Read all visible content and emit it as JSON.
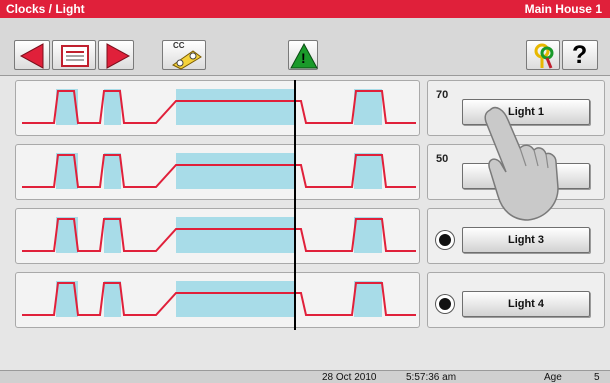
{
  "window": {
    "title": "Clocks / Light",
    "location": "Main House 1"
  },
  "toolbar": {
    "buttons": [
      {
        "icon": "arrow-left-icon"
      },
      {
        "icon": "list-card-icon"
      },
      {
        "icon": "arrow-right-icon"
      },
      {
        "icon": "clock-edit-icon",
        "badge": "CC"
      },
      {
        "icon": "warning-icon",
        "glyph": "!"
      },
      {
        "icon": "keys-icon"
      },
      {
        "icon": "help-icon",
        "glyph": "?"
      }
    ]
  },
  "lights": [
    {
      "label": "Light 1",
      "value": "70"
    },
    {
      "label": "Light 2",
      "value": "50"
    },
    {
      "label": "Light 3",
      "value": ""
    },
    {
      "label": "Light 4",
      "value": ""
    }
  ],
  "status": {
    "date": "28 Oct 2010",
    "time": "5:57:36 am",
    "age_label": "Age",
    "age_value": "5"
  },
  "colors": {
    "title_bar": "#e0203a",
    "curve": "#e0203a",
    "fill": "#a8dce8"
  }
}
